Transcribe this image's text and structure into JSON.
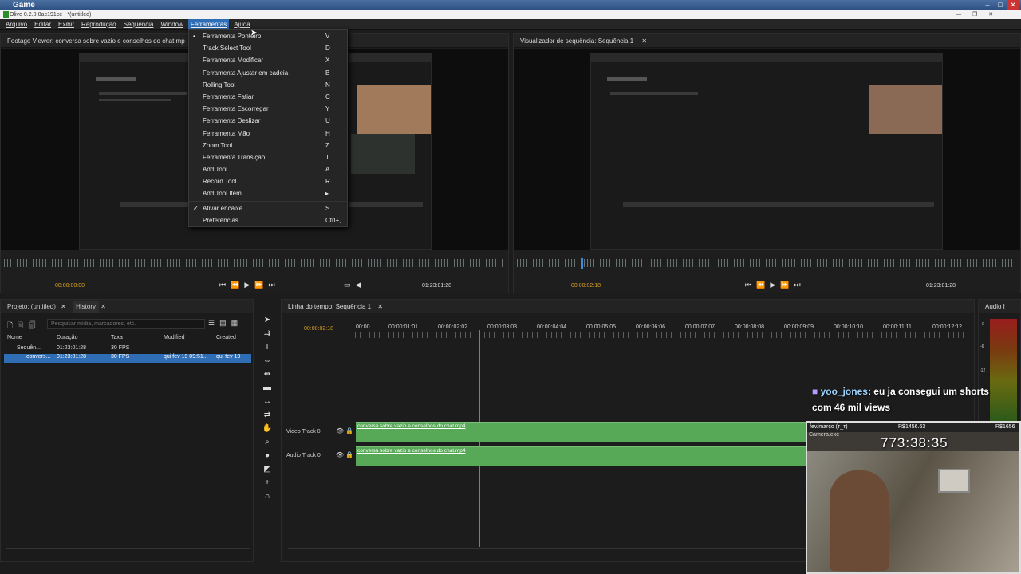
{
  "obs": {
    "title": "Game"
  },
  "window": {
    "title": "Olive 0.2.0-8ac191ce - *(untitled)",
    "controls": [
      "—",
      "❐",
      "✕"
    ]
  },
  "menubar": {
    "items": [
      "Arquivo",
      "Editar",
      "Exibir",
      "Reprodução",
      "Sequência",
      "Window",
      "Ferramentas",
      "Ajuda"
    ],
    "active": "Ferramentas"
  },
  "footage_viewer": {
    "title": "Footage Viewer: conversa sobre vazio e conselhos do chat.mp",
    "tc_current": "00:00:00:00",
    "tc_duration": "01:23:01:28"
  },
  "sequence_viewer": {
    "title": "Visualizador de sequência: Sequência 1",
    "tc_current": "00:00:02:18",
    "tc_duration": "01:23:01:28"
  },
  "tools_menu": {
    "items": [
      {
        "label": "Ferramenta Ponteiro",
        "shortcut": "V",
        "mark": "•"
      },
      {
        "label": "Track Select Tool",
        "shortcut": "D",
        "mark": ""
      },
      {
        "label": "Ferramenta Modificar",
        "shortcut": "X",
        "mark": ""
      },
      {
        "label": "Ferramenta Ajustar em cadeia",
        "shortcut": "B",
        "mark": ""
      },
      {
        "label": "Rolling Tool",
        "shortcut": "N",
        "mark": ""
      },
      {
        "label": "Ferramenta Fatiar",
        "shortcut": "C",
        "mark": ""
      },
      {
        "label": "Ferramenta Escorregar",
        "shortcut": "Y",
        "mark": ""
      },
      {
        "label": "Ferramenta Deslizar",
        "shortcut": "U",
        "mark": ""
      },
      {
        "label": "Ferramenta Mão",
        "shortcut": "H",
        "mark": ""
      },
      {
        "label": "Zoom Tool",
        "shortcut": "Z",
        "mark": ""
      },
      {
        "label": "Ferramenta Transição",
        "shortcut": "T",
        "mark": ""
      },
      {
        "label": "Add Tool",
        "shortcut": "A",
        "mark": ""
      },
      {
        "label": "Record Tool",
        "shortcut": "R",
        "mark": ""
      },
      {
        "label": "Add Tool Item",
        "shortcut": "▸",
        "mark": ""
      }
    ],
    "items2": [
      {
        "label": "Ativar encaixe",
        "shortcut": "S",
        "mark": "✓"
      },
      {
        "label": "Preferências",
        "shortcut": "Ctrl+,",
        "mark": ""
      }
    ]
  },
  "project": {
    "tabs": [
      "Projeto: (untitled)",
      "History"
    ],
    "search_placeholder": "Pesquisar mídia, marcadores, etc.",
    "columns": [
      "Nome",
      "Duração",
      "Taxa",
      "Modified",
      "Created"
    ],
    "rows": [
      {
        "name": "Sequên...",
        "duration": "01:23:01:28",
        "rate": "30 FPS",
        "modified": "",
        "created": ""
      },
      {
        "name": "convers...",
        "duration": "01:23:01:28",
        "rate": "30 FPS",
        "modified": "qui fev 19 09:51...",
        "created": "qui fev 19"
      }
    ]
  },
  "timeline": {
    "title": "Linha do tempo: Sequência 1",
    "tc_current": "00:00:02:18",
    "ticks": [
      "00:00",
      "00:00:01:01",
      "00:00:02:02",
      "00:00:03:03",
      "00:00:04:04",
      "00:00:05:05",
      "00:00:06:06",
      "00:00:07:07",
      "00:00:08:08",
      "00:00:09:09",
      "00:00:10:10",
      "00:00:11:11",
      "00:00:12:12"
    ],
    "tracks": [
      {
        "name": "Video Track 0",
        "clip": "conversa sobre vazio e conselhos do chat.mp4"
      },
      {
        "name": "Audio Track 0",
        "clip": "conversa sobre vazio e conselhos do chat.mp4"
      }
    ]
  },
  "audio_panel": {
    "title": "Audio I",
    "db_labels": [
      "0",
      "-6",
      "-12"
    ]
  },
  "overlay": {
    "chat_user": "yoo_jones",
    "chat_text": ": eu ja consegui um shorts",
    "chat_text2": "com 46 mil views",
    "cam_label": "fev/março (ᴛ_ᴛ)",
    "money1": "R$1456.63",
    "money2": "R$1656",
    "cam_app": "Camera.exe",
    "counter": "773:38:35"
  }
}
